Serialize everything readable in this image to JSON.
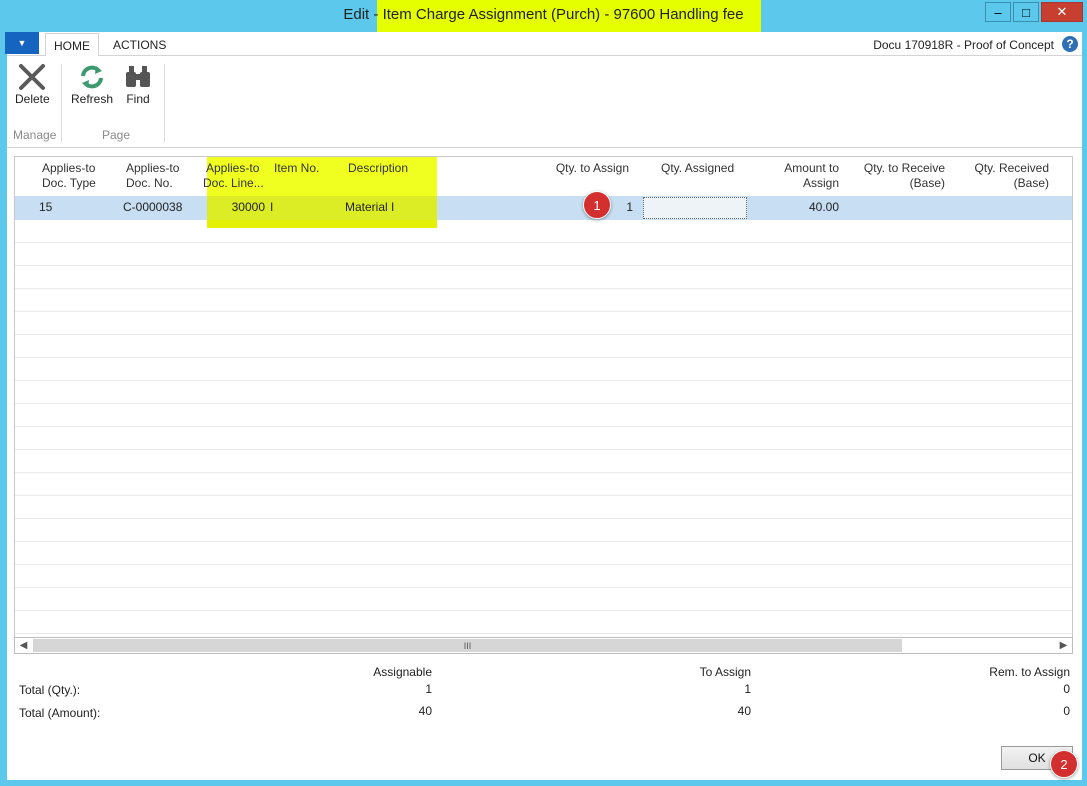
{
  "window": {
    "title_prefix": "Edit",
    "title_main": "- Item Charge Assignment (Purch) - 97600 Handling fee",
    "minimize_glyph": "‒",
    "maximize_glyph": "□",
    "close_glyph": "✕"
  },
  "ribbon": {
    "tabs": [
      {
        "label": "HOME",
        "active": true
      },
      {
        "label": "ACTIONS",
        "active": false
      }
    ],
    "document_name": "Docu 170918R - Proof of Concept",
    "buttons": {
      "delete": "Delete",
      "refresh": "Refresh",
      "find": "Find"
    },
    "groups": {
      "manage": "Manage",
      "page": "Page"
    }
  },
  "grid": {
    "headers": {
      "doc_type": [
        "Applies-to",
        "Doc. Type"
      ],
      "doc_no": [
        "Applies-to",
        "Doc. No."
      ],
      "doc_line": [
        "Applies-to",
        "Doc. Line..."
      ],
      "item_no": "Item No.",
      "description": "Description",
      "qty_to_assign": "Qty. to Assign",
      "qty_assigned": "Qty. Assigned",
      "amount_to_assign": [
        "Amount to",
        "Assign"
      ],
      "qty_to_receive": [
        "Qty. to Receive",
        "(Base)"
      ],
      "qty_received": [
        "Qty. Received",
        "(Base)"
      ]
    },
    "rows": [
      {
        "doc_type": "15",
        "doc_no": "C-0000038",
        "doc_line": "30000",
        "item_no": "I",
        "description": "Material I",
        "qty_to_assign": "1",
        "qty_assigned": "",
        "amount_to_assign": "40.00",
        "qty_to_receive": "",
        "qty_received": ""
      }
    ],
    "scroll_thumb_glyph": "III"
  },
  "totals": {
    "col_headers": {
      "assignable": "Assignable",
      "to_assign": "To Assign",
      "rem_to_assign": "Rem. to Assign"
    },
    "qty": {
      "label": "Total (Qty.):",
      "assignable": "1",
      "to_assign": "1",
      "rem": "0"
    },
    "amount": {
      "label": "Total (Amount):",
      "assignable": "40",
      "to_assign": "40",
      "rem": "0"
    }
  },
  "ok_label": "OK",
  "annotations": {
    "badge1": "1",
    "badge2": "2"
  },
  "colors": {
    "highlight": "#e6ff00",
    "selected_row": "#c8dff3",
    "frame": "#5bc8ec",
    "badge": "#d32f2f"
  }
}
